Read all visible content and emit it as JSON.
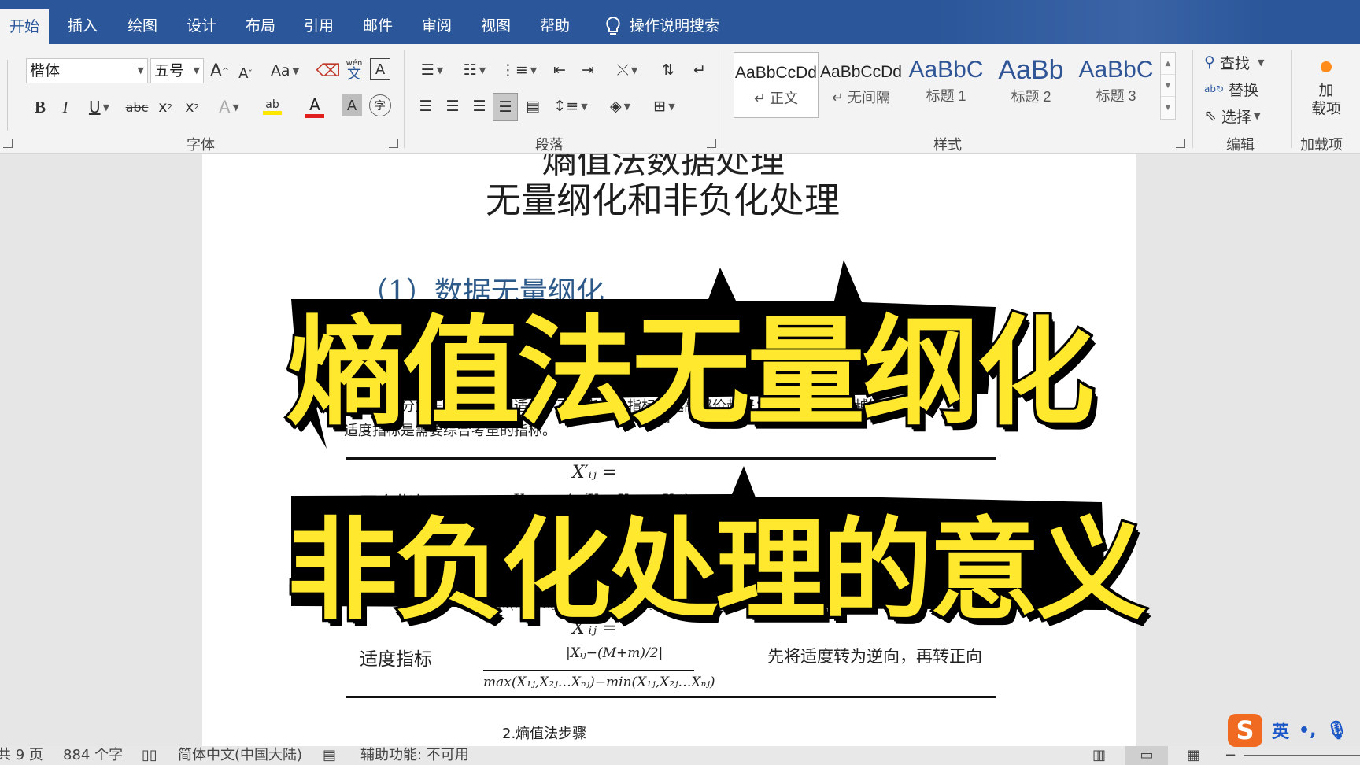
{
  "tabs": [
    {
      "label": "开始",
      "active": true
    },
    {
      "label": "插入"
    },
    {
      "label": "绘图"
    },
    {
      "label": "设计"
    },
    {
      "label": "布局"
    },
    {
      "label": "引用"
    },
    {
      "label": "邮件"
    },
    {
      "label": "审阅"
    },
    {
      "label": "视图"
    },
    {
      "label": "帮助"
    }
  ],
  "tell_me": "操作说明搜索",
  "font_group": {
    "label": "字体",
    "font_name": "楷体",
    "font_size": "五号",
    "case_label": "Aa",
    "phonetic_top": "wén",
    "phonetic_bottom": "文",
    "border_char": "A",
    "bold": "B",
    "italic": "I",
    "underline": "U",
    "strike": "abc",
    "sub": "x",
    "sup": "x",
    "effects": "A",
    "highlight": "ab",
    "font_color": "A",
    "char_shade": "A",
    "enclose": "字",
    "grow": "A",
    "shrink": "A"
  },
  "paragraph_group": {
    "label": "段落"
  },
  "styles_group": {
    "label": "样式",
    "items": [
      {
        "sample": "AaBbCcDd",
        "name": "↵ 正文"
      },
      {
        "sample": "AaBbCcDd",
        "name": "↵ 无间隔"
      },
      {
        "sample": "AaBbC",
        "name": "标题 1"
      },
      {
        "sample": "AaBb",
        "name": "标题 2"
      },
      {
        "sample": "AaBbC",
        "name": "标题 3"
      }
    ]
  },
  "editing_group": {
    "label": "编辑",
    "find": "查找",
    "replace": "替换",
    "select": "选择"
  },
  "addins_group": {
    "label": "加载项",
    "button_line1": "加",
    "button_line2": "载项"
  },
  "document": {
    "title_clipped": "熵值法数据处理",
    "title": "无量纲化和非负化处理",
    "heading": "（1）数据无量纲化",
    "line1": "指标性质分为正向、逆向和适度。正向指标是指标值越高评价越好；逆向指标越小越好；",
    "line2": "适度指标是需要综合考量的指标。",
    "row_positive": "正向指标",
    "row_moderate": "适度指标",
    "x_prime": "X′ᵢⱼ =",
    "frac_pos_num": "Xᵢⱼ − min(X₁ⱼ, X₂ⱼ … Xₙⱼ)",
    "frac_neg_num": "max(X₁ⱼ, X₂ⱼ … Xₙⱼ) − Xᵢⱼ",
    "frac_den": "max(X₁ⱼ,X₂ⱼ…Xₙⱼ)−min(X₁ⱼ,X₂ⱼ…Xₙⱼ)",
    "frac_mod_num": "|Xᵢⱼ−(M+m)/2|",
    "moderate_note": "先将适度转为逆向，再转正向",
    "next_step": "2.熵值法步骤"
  },
  "overlay": {
    "line1": "熵值法无量纲化",
    "line2": "非负化处理的意义"
  },
  "status": {
    "pages": "共 9 页",
    "words": "884 个字",
    "language": "简体中文(中国大陆)",
    "accessibility": "辅助功能: 不可用"
  },
  "ime": {
    "logo": "S",
    "lang": "英"
  },
  "colors": {
    "ribbon_blue": "#2b579a",
    "overlay_yellow": "#ffe82e",
    "heading_blue": "#2e5a8a"
  }
}
